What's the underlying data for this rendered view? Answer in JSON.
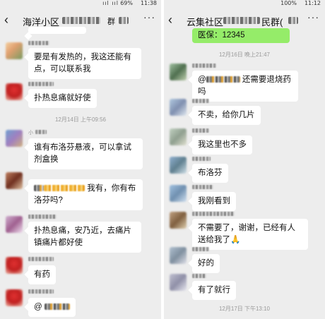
{
  "left": {
    "status": {
      "signal": "ııl ııl",
      "battery": "69%",
      "time": "11:38"
    },
    "title": "海洋小区",
    "title_suffix": "群",
    "more_label": "···",
    "back_label": "‹",
    "messages": [
      {
        "text": "要是有发热的，我这还能有点，可以联系我"
      },
      {
        "text": "扑热息痛就好使"
      },
      {
        "timestamp": "12月14日 上午09:56"
      },
      {
        "nick": "小",
        "text": "谁有布洛芬悬液，可以拿试剂盒换"
      },
      {
        "text_after": "我有，你有布洛芬吗?"
      },
      {
        "text": "扑热息痛，安乃近，去痛片镇痛片都好使"
      },
      {
        "text": "有药"
      },
      {
        "text": "@"
      }
    ]
  },
  "right": {
    "status": {
      "battery": "100%",
      "time": "11:12"
    },
    "title": "云集社区",
    "title_suffix": "民群(",
    "more_label": "···",
    "back_label": "‹",
    "top_bubble": "医保：12345",
    "messages": [
      {
        "timestamp": "12月16日 晚上21:47"
      },
      {
        "text_prefix": "@",
        "text_after": "还需要退烧药吗"
      },
      {
        "text": "不卖，给你几片"
      },
      {
        "text": "我这里也不多"
      },
      {
        "text": "布洛芬"
      },
      {
        "text": "我刚看到"
      },
      {
        "text": "不需要了，谢谢，已经有人送给我了🙏"
      },
      {
        "text": "好的"
      },
      {
        "text": "有了就行"
      },
      {
        "timestamp": "12月17日 下午13:10"
      }
    ]
  }
}
